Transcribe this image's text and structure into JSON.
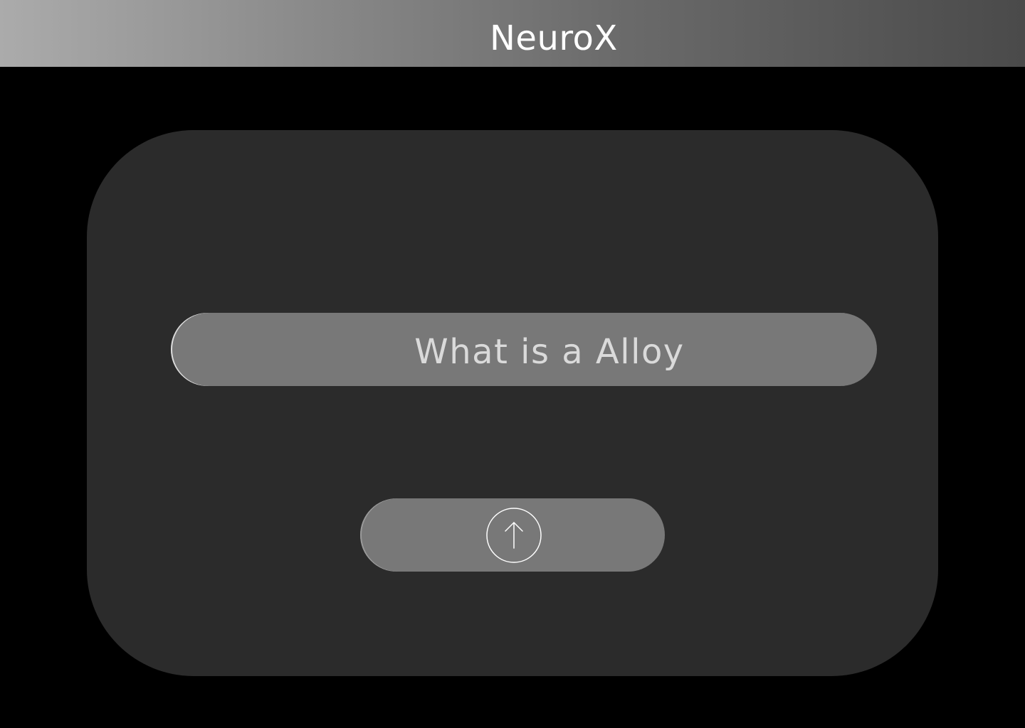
{
  "header": {
    "title": "NeuroX"
  },
  "query": {
    "text": "What is a Alloy"
  },
  "send_button": {
    "icon": "arrow-up-circle-icon"
  },
  "colors": {
    "background": "#000000",
    "panel": "#2b2b2b",
    "pill": "#787878",
    "header_gradient_start": "#ababab",
    "header_gradient_end": "#4a4a4a",
    "text_primary": "#ffffff",
    "text_query": "#dadada"
  }
}
